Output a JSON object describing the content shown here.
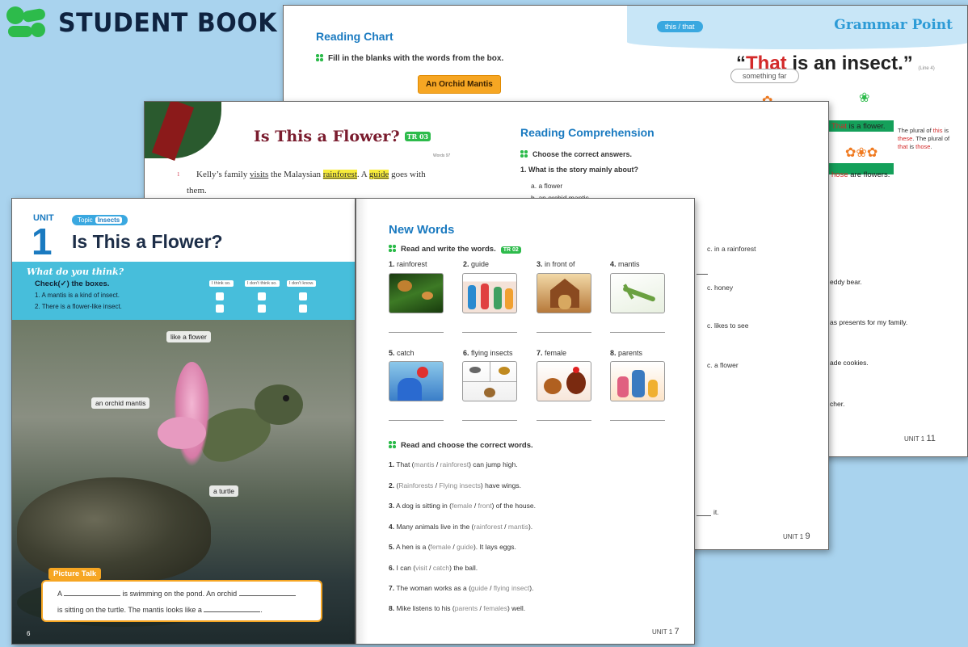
{
  "brand": {
    "title": "STUDENT BOOK"
  },
  "back_page": {
    "reading_chart_title": "Reading Chart",
    "reading_chart_instruction": "Fill in the blanks with the words from the box.",
    "box_label": "An Orchid Mantis",
    "grammar_tag": "this / that",
    "grammar_title": "Grammar Point",
    "grammar_sentence_hl": "That",
    "grammar_sentence_rest": " is an insect.",
    "grammar_quote_open": "“",
    "grammar_quote_close": "”",
    "grammar_ref": "(Line 4)",
    "something_far": "something far",
    "that_flower_hl": "That",
    "that_flower_rest": " is a flower.",
    "those_hl": "hose",
    "those_rest": " are flowers.",
    "plural_note_1": "The plural of ",
    "plural_note_this": "this",
    "plural_note_2": " is ",
    "plural_note_these": "these",
    "plural_note_3": ". The plural of ",
    "plural_note_that": "that",
    "plural_note_4": " is ",
    "plural_note_those": "those",
    "plural_note_5": ".",
    "side_lines": [
      "eddy bear.",
      "as presents for my family.",
      "ade cookies.",
      "cher."
    ],
    "page_unit": "UNIT 1",
    "page_num": "11"
  },
  "middle_page": {
    "story_title": "Is This a Flower?",
    "story_audio": "TR 03",
    "story_words": "Words 97",
    "line_num": "1",
    "story_line1_a": "Kelly’s family ",
    "story_line1_visits": "visits",
    "story_line1_b": " the Malaysian ",
    "story_line1_rainforest": "rainforest",
    "story_line1_c": ". A ",
    "story_line1_guide": "guide",
    "story_line1_d": " goes with",
    "story_line2": "them.",
    "comp_title": "Reading Comprehension",
    "comp_instruction": "Choose the correct answers.",
    "comp_q1": "1.  What is the story mainly about?",
    "comp_q1_a": "a. a flower",
    "comp_q1_b": "b. an orchid mantis",
    "comp_options_c": [
      "c. in a rainforest",
      "c. honey",
      "c. likes to see",
      "c. a flower"
    ],
    "blank_it": "it.",
    "page_unit": "UNIT 1",
    "page_num": "9"
  },
  "front_left": {
    "unit_label": "UNIT",
    "unit_number": "1",
    "topic_label": "Topic",
    "topic_name": "Insects",
    "title": "Is This a Flower?",
    "what_do_you_think": "What do you think?",
    "check_instruction": "Check(✓) the boxes.",
    "items": [
      "1.  A mantis is a kind of insect.",
      "2.  There is a flower-like insect."
    ],
    "options": [
      "I think so.",
      "I don't think so.",
      "I don't know."
    ],
    "photo_labels": {
      "like_flower": "like a flower",
      "orchid_mantis": "an orchid mantis",
      "turtle": "a turtle"
    },
    "picture_talk": "Picture Talk",
    "pt_line1_a": "A ",
    "pt_line1_b": " is swimming on the pond. An orchid ",
    "pt_line2_a": "is sitting on the turtle. The mantis looks like a ",
    "pt_line2_b": ".",
    "page_num": "6"
  },
  "front_right": {
    "title": "New Words",
    "instruction": "Read and write the words.",
    "audio": "TR 02",
    "words": [
      {
        "num": "1.",
        "word": "rainforest"
      },
      {
        "num": "2.",
        "word": "guide"
      },
      {
        "num": "3.",
        "word": "in front of"
      },
      {
        "num": "4.",
        "word": "mantis"
      },
      {
        "num": "5.",
        "word": "catch"
      },
      {
        "num": "6.",
        "word": "flying insects"
      },
      {
        "num": "7.",
        "word": "female"
      },
      {
        "num": "8.",
        "word": "parents"
      }
    ],
    "instruction2": "Read and choose the correct words.",
    "sentences": [
      {
        "num": "1.",
        "a": "That (",
        "o1": "mantis",
        "sep": " / ",
        "o2": "rainforest",
        "b": ") can jump high."
      },
      {
        "num": "2.",
        "a": "(",
        "o1": "Rainforests",
        "sep": " / ",
        "o2": "Flying insects",
        "b": ") have wings."
      },
      {
        "num": "3.",
        "a": "A dog is sitting in (",
        "o1": "female",
        "sep": " / ",
        "o2": "front",
        "b": ") of the house."
      },
      {
        "num": "4.",
        "a": "Many animals live in the (",
        "o1": "rainforest",
        "sep": " / ",
        "o2": "mantis",
        "b": ")."
      },
      {
        "num": "5.",
        "a": "A hen is a (",
        "o1": "female",
        "sep": " / ",
        "o2": "guide",
        "b": "). It lays eggs."
      },
      {
        "num": "6.",
        "a": "I can (",
        "o1": "visit",
        "sep": " / ",
        "o2": "catch",
        "b": ") the ball."
      },
      {
        "num": "7.",
        "a": "The woman works as a (",
        "o1": "guide",
        "sep": " / ",
        "o2": "flying insect",
        "b": ")."
      },
      {
        "num": "8.",
        "a": "Mike listens to his (",
        "o1": "parents",
        "sep": " / ",
        "o2": "females",
        "b": ") well."
      }
    ],
    "page_unit": "UNIT 1",
    "page_num": "7"
  }
}
